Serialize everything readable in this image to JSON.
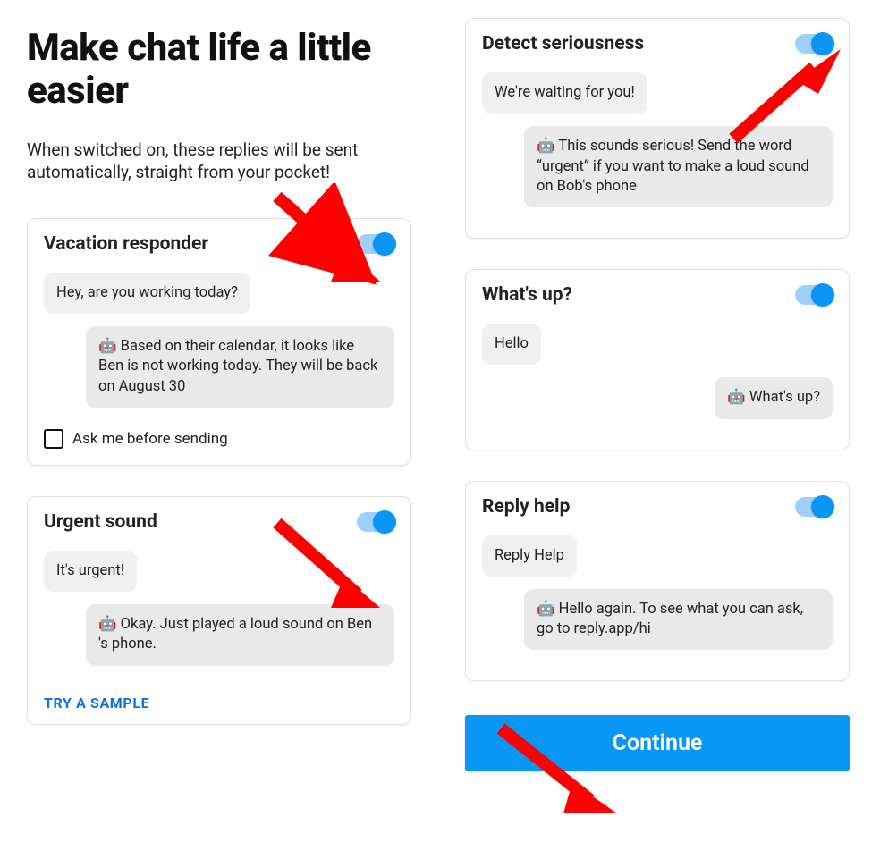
{
  "header": {
    "title": "Make chat life a little easier",
    "subtitle": "When switched on, these replies will be sent automatically, straight from your pocket!"
  },
  "cards": {
    "vacation": {
      "title": "Vacation responder",
      "incoming": "Hey, are you working today?",
      "reply": "🤖 Based on their calendar, it looks like Ben is not working today. They will be back on August 30",
      "checkbox_label": "Ask me before sending"
    },
    "urgent": {
      "title": "Urgent sound",
      "incoming": "It's urgent!",
      "reply": "🤖 Okay. Just played a loud sound on Ben 's phone.",
      "sample_link": "TRY A SAMPLE"
    },
    "serious": {
      "title": "Detect seriousness",
      "incoming": "We're waiting for you!",
      "reply": "🤖 This sounds serious! Send the word “urgent” if you want to make a loud sound on Bob's phone"
    },
    "whatsup": {
      "title": "What's up?",
      "incoming": "Hello",
      "reply": "🤖 What's up?"
    },
    "replyhelp": {
      "title": "Reply help",
      "incoming": "Reply Help",
      "reply": "🤖 Hello again. To see what you can ask, go to reply.app/hi"
    }
  },
  "continue_label": "Continue"
}
